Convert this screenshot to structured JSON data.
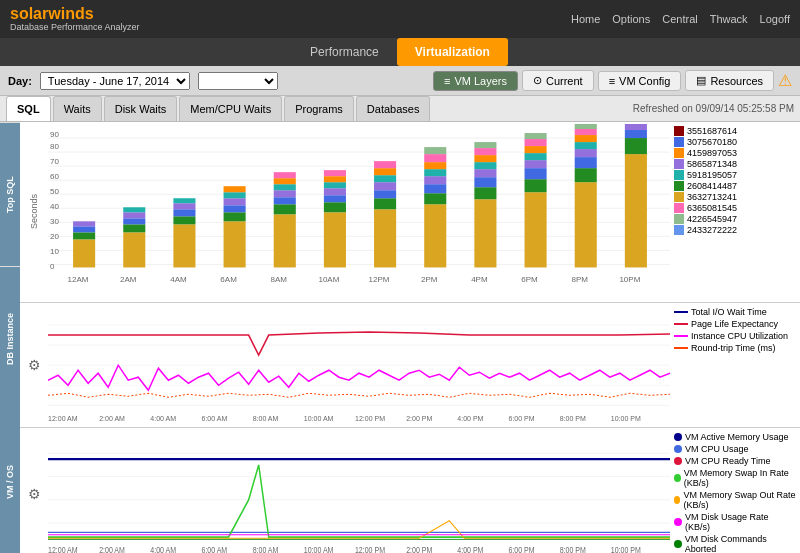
{
  "header": {
    "logo": "solarwinds",
    "subtitle": "Database Performance Analyzer",
    "nav": [
      "Home",
      "Options",
      "Central",
      "Thwack",
      "Logoff"
    ]
  },
  "topNav": {
    "items": [
      "Performance",
      "Virtualization"
    ],
    "active": "Virtualization"
  },
  "vmTabs": {
    "items": [
      {
        "label": "VM Layers",
        "icon": "≡",
        "active": true
      },
      {
        "label": "Current",
        "icon": "⊙",
        "active": false
      },
      {
        "label": "VM Config",
        "icon": "≡",
        "active": false
      },
      {
        "label": "Resources",
        "icon": "▤",
        "active": false
      }
    ],
    "refresh": "Refreshed on 09/09/14 05:25:58 PM"
  },
  "dayBar": {
    "label": "Day:",
    "value": "Tuesday - June 17, 2014"
  },
  "subTabs": {
    "items": [
      "SQL",
      "Waits",
      "Disk Waits",
      "Mem/CPU Waits",
      "Programs",
      "Databases"
    ],
    "active": "SQL"
  },
  "topSqlSection": {
    "yLabel": "Seconds",
    "sideLabel": "Top SQL",
    "xLabels": [
      "12AM",
      "2AM",
      "4AM",
      "6AM",
      "8AM",
      "10AM",
      "12PM",
      "2PM",
      "4PM",
      "6PM",
      "8PM",
      "10PM"
    ],
    "legend": [
      {
        "color": "#8B0000",
        "label": "3551687614"
      },
      {
        "color": "#4169E1",
        "label": "3075670180"
      },
      {
        "color": "#FF8C00",
        "label": "4159897053"
      },
      {
        "color": "#9370DB",
        "label": "5865871348"
      },
      {
        "color": "#20B2AA",
        "label": "5918195057"
      },
      {
        "color": "#32CD32",
        "label": "2608414487"
      },
      {
        "color": "#DAA520",
        "label": "3632713241"
      },
      {
        "color": "#FF69B4",
        "label": "6365081545"
      },
      {
        "color": "#8FBC8F",
        "label": "4226545947"
      },
      {
        "color": "#6495ED",
        "label": "2433272222"
      }
    ]
  },
  "dbInstanceSection": {
    "sideLabel": "DB Instance",
    "xLabels": [
      "12:00 AM",
      "2:00 AM",
      "4:00 AM",
      "6:00 AM",
      "8:00 AM",
      "10:00 AM",
      "12:00 PM",
      "2:00 PM",
      "4:00 PM",
      "6:00 PM",
      "8:00 PM",
      "10:00 PM"
    ],
    "legend": [
      {
        "color": "#00008B",
        "label": "Total I/O Wait Time"
      },
      {
        "color": "#DC143C",
        "label": "Page Life Expectancy"
      },
      {
        "color": "#FF00FF",
        "label": "Instance CPU Utilization"
      },
      {
        "color": "#FF4500",
        "label": "Round-trip Time (ms)"
      }
    ]
  },
  "vmOsSection": {
    "sideLabel": "VM / OS",
    "xLabels": [
      "12:00 AM",
      "2:00 AM",
      "4:00 AM",
      "6:00 AM",
      "8:00 AM",
      "10:00 AM",
      "12:00 PM",
      "2:00 PM",
      "4:00 PM",
      "6:00 PM",
      "8:00 PM",
      "10:00 PM"
    ],
    "legend": [
      {
        "color": "#00008B",
        "label": "VM Active Memory Usage"
      },
      {
        "color": "#4169E1",
        "label": "VM CPU Usage"
      },
      {
        "color": "#DC143C",
        "label": "VM CPU Ready Time"
      },
      {
        "color": "#32CD32",
        "label": "VM Memory Swap In Rate (KB/s)"
      },
      {
        "color": "#FFA500",
        "label": "VM Memory Swap Out Rate (KB/s)"
      },
      {
        "color": "#FF00FF",
        "label": "VM Disk Usage Rate (KB/s)"
      },
      {
        "color": "#008000",
        "label": "VM Disk Commands Aborted"
      }
    ]
  }
}
